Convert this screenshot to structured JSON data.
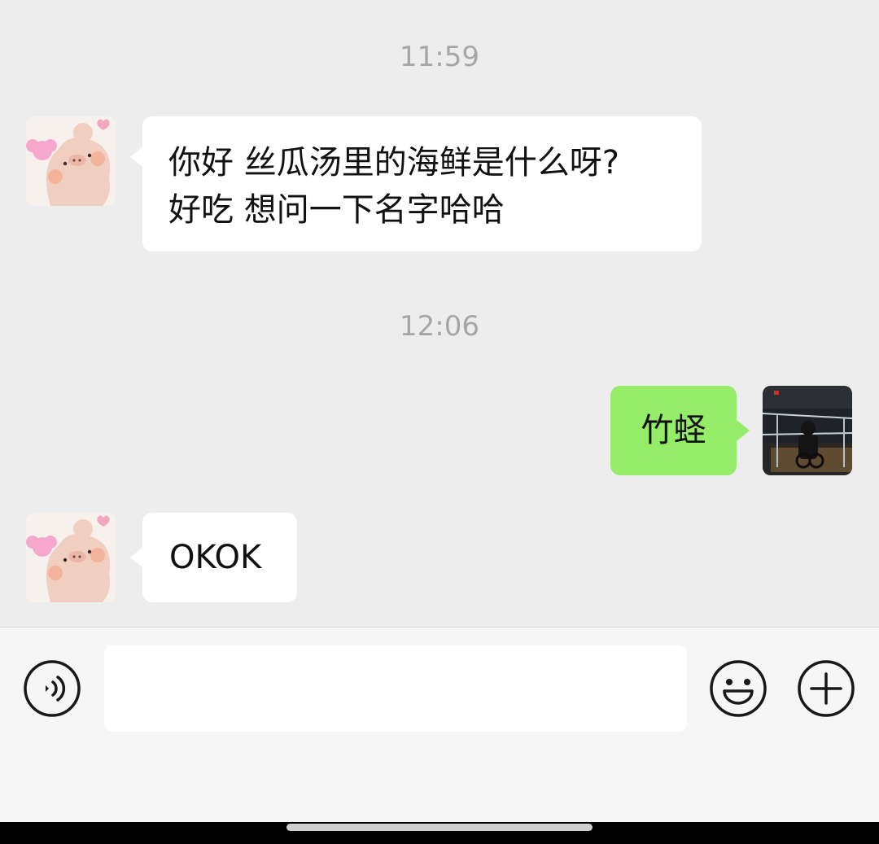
{
  "chat": {
    "messages": [
      {
        "type": "timestamp",
        "text": "11:59"
      },
      {
        "type": "incoming",
        "sender_avatar": "pig-sticker-avatar",
        "lines": [
          "你好 丝瓜汤里的海鲜是什么呀?",
          "好吃 想问一下名字哈哈"
        ]
      },
      {
        "type": "timestamp",
        "text": "12:06"
      },
      {
        "type": "outgoing",
        "sender_avatar": "photo-avatar",
        "text": "竹蛏"
      },
      {
        "type": "incoming",
        "sender_avatar": "pig-sticker-avatar",
        "text": "OKOK"
      }
    ]
  },
  "input_bar": {
    "voice_icon": "voice-icon",
    "emoji_icon": "emoji-icon",
    "plus_icon": "plus-icon",
    "text_value": ""
  },
  "colors": {
    "background": "#ededed",
    "incoming_bubble": "#ffffff",
    "outgoing_bubble": "#95ec69",
    "timestamp": "#a6a6a6"
  }
}
